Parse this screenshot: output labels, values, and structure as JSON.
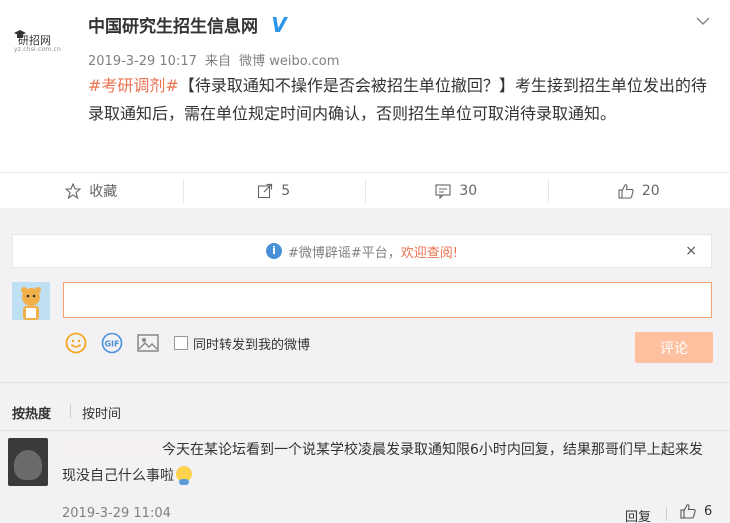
{
  "post": {
    "logo_text": "研招网",
    "logo_url": "yz.chsi.com.cn",
    "author": "中国研究生招生信息网",
    "verified_mark": "V",
    "timestamp": "2019-3-29 10:17",
    "source_prefix": "来自",
    "source": "微博 weibo.com",
    "hashtag": "#考研调剂#",
    "text": "【待录取通知不操作是否会被招生单位撤回？】考生接到招生单位发出的待录取通知后，需在单位规定时间内确认，否则招生单位可取消待录取通知。"
  },
  "actions": {
    "favorite_label": "收藏",
    "repost_count": "5",
    "comment_count": "30",
    "like_count": "20"
  },
  "rumor_bar": {
    "text": "#微博辟谣#平台，",
    "welcome": "欢迎查阅!",
    "close": "×"
  },
  "composer": {
    "input_value": "",
    "sync_label": "同时转发到我的微博",
    "submit_label": "评论",
    "gif_label": "GIF"
  },
  "sort": {
    "hot_label": "按热度",
    "time_label": "按时间"
  },
  "comments": [
    {
      "text": "今天在某论坛看到一个说某学校凌晨发录取通知限6小时内回复，结果那哥们早上起来发现没自己什么事啦",
      "time": "2019-3-29 11:04",
      "reply_label": "回复",
      "likes": "6"
    }
  ],
  "colors": {
    "accent": "#eb7350",
    "verified": "#2d95e6",
    "submit_disabled": "#ffc09f"
  }
}
